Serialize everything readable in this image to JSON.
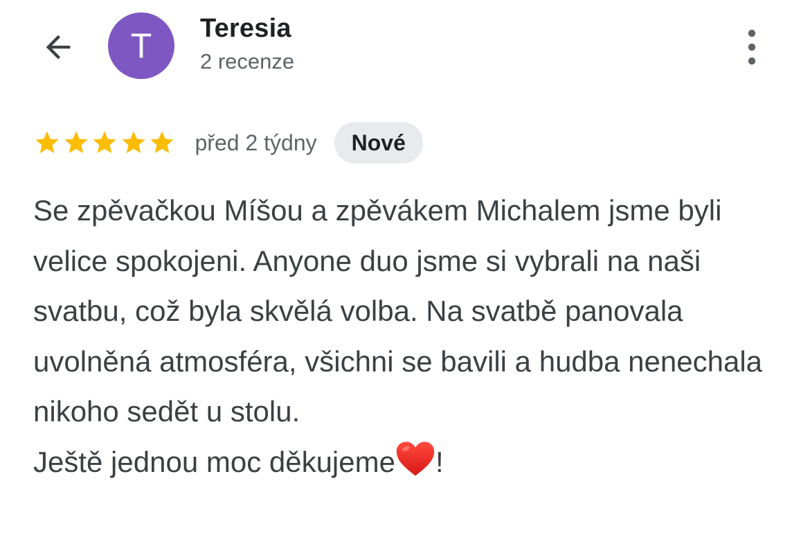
{
  "header": {
    "back_icon": "arrow-left-icon",
    "avatar_letter": "T",
    "avatar_color": "#7e57c2",
    "name": "Teresia",
    "subtitle": "2 recenze",
    "more_icon": "more-vertical-icon"
  },
  "review": {
    "rating": 5,
    "rating_max": 5,
    "star_color": "#fbbc04",
    "date": "před 2 týdny",
    "badge": "Nové",
    "text": "Se zpěvačkou Míšou a zpěvákem Michalem jsme byli velice spokojeni. Anyone duo jsme si vybrali na naši svatbu, což byla skvělá volba. Na svatbě panovala uvolněná atmosféra, všichni se bavili a hudba nenechala nikoho sedět u stolu.",
    "closing": "Ještě jednou moc děkujeme",
    "closing_emoji": "heart-icon",
    "closing_punct": "!"
  }
}
